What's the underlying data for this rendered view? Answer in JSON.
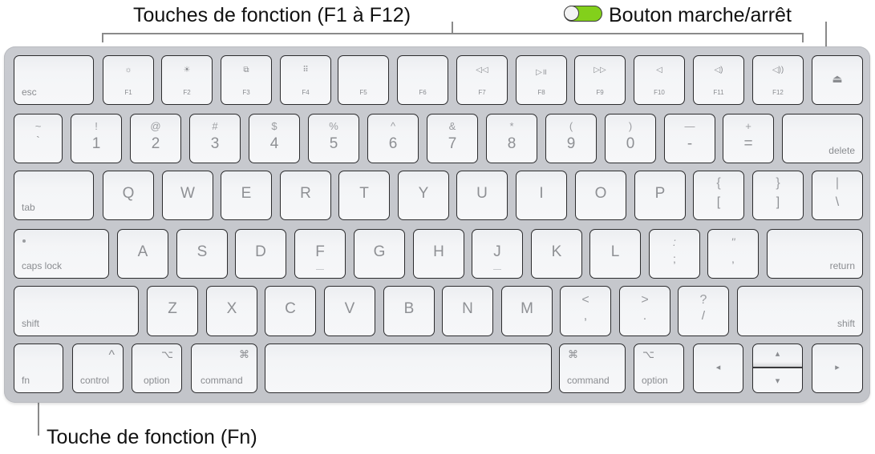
{
  "callouts": {
    "function_keys": "Touches de fonction (F1 à F12)",
    "power_button": "Bouton marche/arrêt",
    "fn_key": "Touche de fonction (Fn)"
  },
  "toggle": {
    "state": "on",
    "color_on": "#83d01b"
  },
  "keyboard": {
    "row1": {
      "esc": "esc",
      "fkeys": [
        {
          "label": "F1",
          "icon": "☼"
        },
        {
          "label": "F2",
          "icon": "☀"
        },
        {
          "label": "F3",
          "icon": "⧉"
        },
        {
          "label": "F4",
          "icon": "⠿"
        },
        {
          "label": "F5",
          "icon": ""
        },
        {
          "label": "F6",
          "icon": ""
        },
        {
          "label": "F7",
          "icon": "◁◁"
        },
        {
          "label": "F8",
          "icon": "▷॥"
        },
        {
          "label": "F9",
          "icon": "▷▷"
        },
        {
          "label": "F10",
          "icon": "◁"
        },
        {
          "label": "F11",
          "icon": "◁)"
        },
        {
          "label": "F12",
          "icon": "◁))"
        }
      ],
      "eject": "⏏"
    },
    "row2": {
      "tilde": {
        "up": "~",
        "dn": "`"
      },
      "numbers": [
        {
          "up": "!",
          "dn": "1"
        },
        {
          "up": "@",
          "dn": "2"
        },
        {
          "up": "#",
          "dn": "3"
        },
        {
          "up": "$",
          "dn": "4"
        },
        {
          "up": "%",
          "dn": "5"
        },
        {
          "up": "^",
          "dn": "6"
        },
        {
          "up": "&",
          "dn": "7"
        },
        {
          "up": "*",
          "dn": "8"
        },
        {
          "up": "(",
          "dn": "9"
        },
        {
          "up": ")",
          "dn": "0"
        },
        {
          "up": "—",
          "dn": "-"
        },
        {
          "up": "+",
          "dn": "="
        }
      ],
      "delete": "delete"
    },
    "row3": {
      "tab": "tab",
      "letters": [
        "Q",
        "W",
        "E",
        "R",
        "T",
        "Y",
        "U",
        "I",
        "O",
        "P"
      ],
      "brackets": [
        {
          "up": "{",
          "dn": "["
        },
        {
          "up": "}",
          "dn": "]"
        },
        {
          "up": "|",
          "dn": "\\"
        }
      ]
    },
    "row4": {
      "caps": "caps lock",
      "letters": [
        "A",
        "S",
        "D",
        "F",
        "G",
        "H",
        "J",
        "K",
        "L"
      ],
      "punct": [
        {
          "up": ":",
          "dn": ";"
        },
        {
          "up": "\"",
          "dn": ","
        }
      ],
      "return": "return"
    },
    "row5": {
      "shift_left": "shift",
      "letters": [
        "Z",
        "X",
        "C",
        "V",
        "B",
        "N",
        "M"
      ],
      "punct": [
        {
          "up": "<",
          "dn": ","
        },
        {
          "up": ">",
          "dn": "."
        },
        {
          "up": "?",
          "dn": "/"
        }
      ],
      "shift_right": "shift"
    },
    "row6": {
      "fn": "fn",
      "control": {
        "label": "control",
        "icon": "^"
      },
      "option_left": {
        "label": "option",
        "icon": "⌥"
      },
      "command_left": {
        "label": "command",
        "icon": "⌘"
      },
      "command_right": {
        "label": "command",
        "icon": "⌘"
      },
      "option_right": {
        "label": "option",
        "icon": "⌥"
      },
      "arrow_left": "◂",
      "arrow_up": "▴",
      "arrow_down": "▾",
      "arrow_right": "▸"
    }
  }
}
